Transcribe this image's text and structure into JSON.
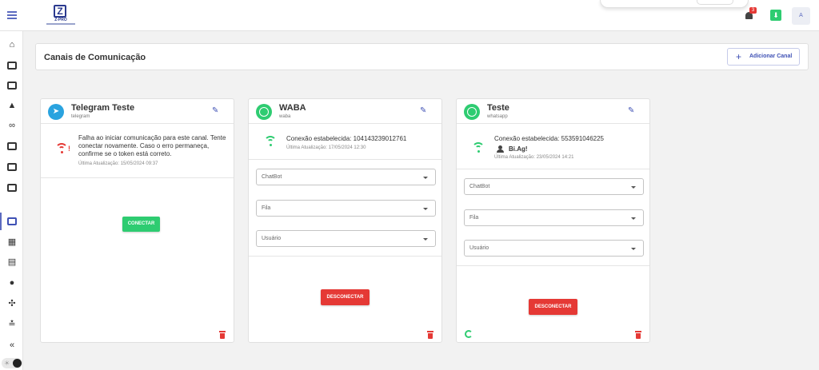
{
  "app": {
    "logo_text": "Z-PRO",
    "notification_count": "3",
    "avatar_initial": "A"
  },
  "page": {
    "title": "Canais de Comunicação",
    "add_button_label": "Adicionar Canal"
  },
  "channels": [
    {
      "name": "Telegram Teste",
      "type": "telegram",
      "status_text": "Falha ao iniciar comunicação para este canal. Tente conectar novamente. Caso o erro permaneça, confirme se o token está correto.",
      "last_update": "Última Atualização: 15/05/2024 09:37",
      "action_label": "CONECTAR"
    },
    {
      "name": "WABA",
      "type": "waba",
      "status_text": "Conexão estabelecida: 104143239012761",
      "last_update": "Última Atualização: 17/05/2024 12:30",
      "selects": [
        "ChatBot",
        "Fila",
        "Usuário"
      ],
      "action_label": "DESCONECTAR"
    },
    {
      "name": "Teste",
      "type": "whatsapp",
      "status_text": "Conexão estabelecida: 553591046225",
      "profile_name": "Bi.Ag!",
      "last_update": "Última Atualização: 23/05/2024 14:21",
      "selects": [
        "ChatBot",
        "Fila",
        "Usuário"
      ],
      "action_label": "DESCONECTAR"
    }
  ],
  "colors": {
    "primary": "#3f51b5",
    "success": "#2ecc71",
    "danger": "#e53935",
    "telegram": "#2aa3df"
  },
  "icons": {
    "sidebar": [
      "home-icon",
      "chat-icon",
      "contacts-icon",
      "rocket-icon",
      "flow-icon",
      "message-icon",
      "calendar-icon",
      "task-icon",
      "channels-icon",
      "kanban-icon",
      "report-icon",
      "users-icon",
      "api-icon",
      "queue-icon",
      "collapse-icon"
    ]
  }
}
